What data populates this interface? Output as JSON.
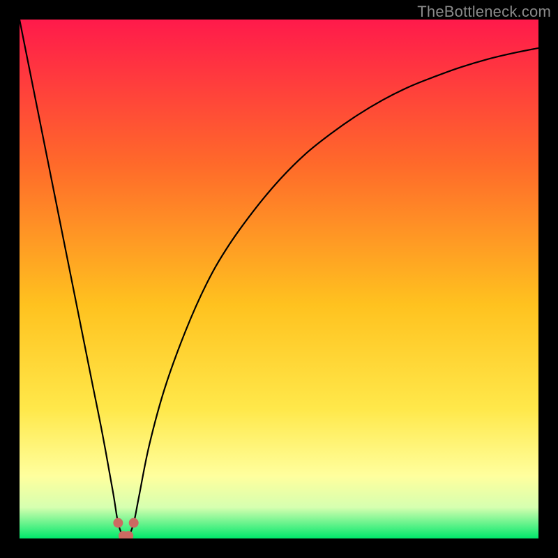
{
  "watermark": "TheBottleneck.com",
  "colors": {
    "black": "#000000",
    "grad_top": "#ff1a4b",
    "grad_mid_orange": "#ff7a1f",
    "grad_mid_yellow": "#ffd400",
    "grad_light_yellow": "#ffff9e",
    "grad_pale": "#e8ffb8",
    "grad_green": "#00e86b",
    "curve": "#000000",
    "markers": "#cc6a62"
  },
  "chart_data": {
    "type": "line",
    "title": "",
    "xlabel": "",
    "ylabel": "",
    "xlim": [
      0,
      100
    ],
    "ylim": [
      0,
      100
    ],
    "series": [
      {
        "name": "bottleneck-curve",
        "x": [
          0,
          2,
          4,
          6,
          8,
          10,
          12,
          14,
          16,
          18,
          19,
          20,
          21,
          22,
          23,
          25,
          28,
          32,
          36,
          40,
          45,
          50,
          55,
          60,
          65,
          70,
          75,
          80,
          85,
          90,
          95,
          100
        ],
        "y": [
          100,
          90,
          80,
          70,
          60,
          50,
          40,
          30,
          20,
          9,
          3,
          0.5,
          0.5,
          3,
          8,
          18,
          29,
          40,
          49,
          56,
          63,
          69,
          74,
          78,
          81.5,
          84.5,
          87,
          89,
          90.8,
          92.3,
          93.5,
          94.5
        ]
      }
    ],
    "markers": [
      {
        "x": 19,
        "y": 3
      },
      {
        "x": 20,
        "y": 0.5
      },
      {
        "x": 21,
        "y": 0.5
      },
      {
        "x": 22,
        "y": 3
      }
    ]
  }
}
